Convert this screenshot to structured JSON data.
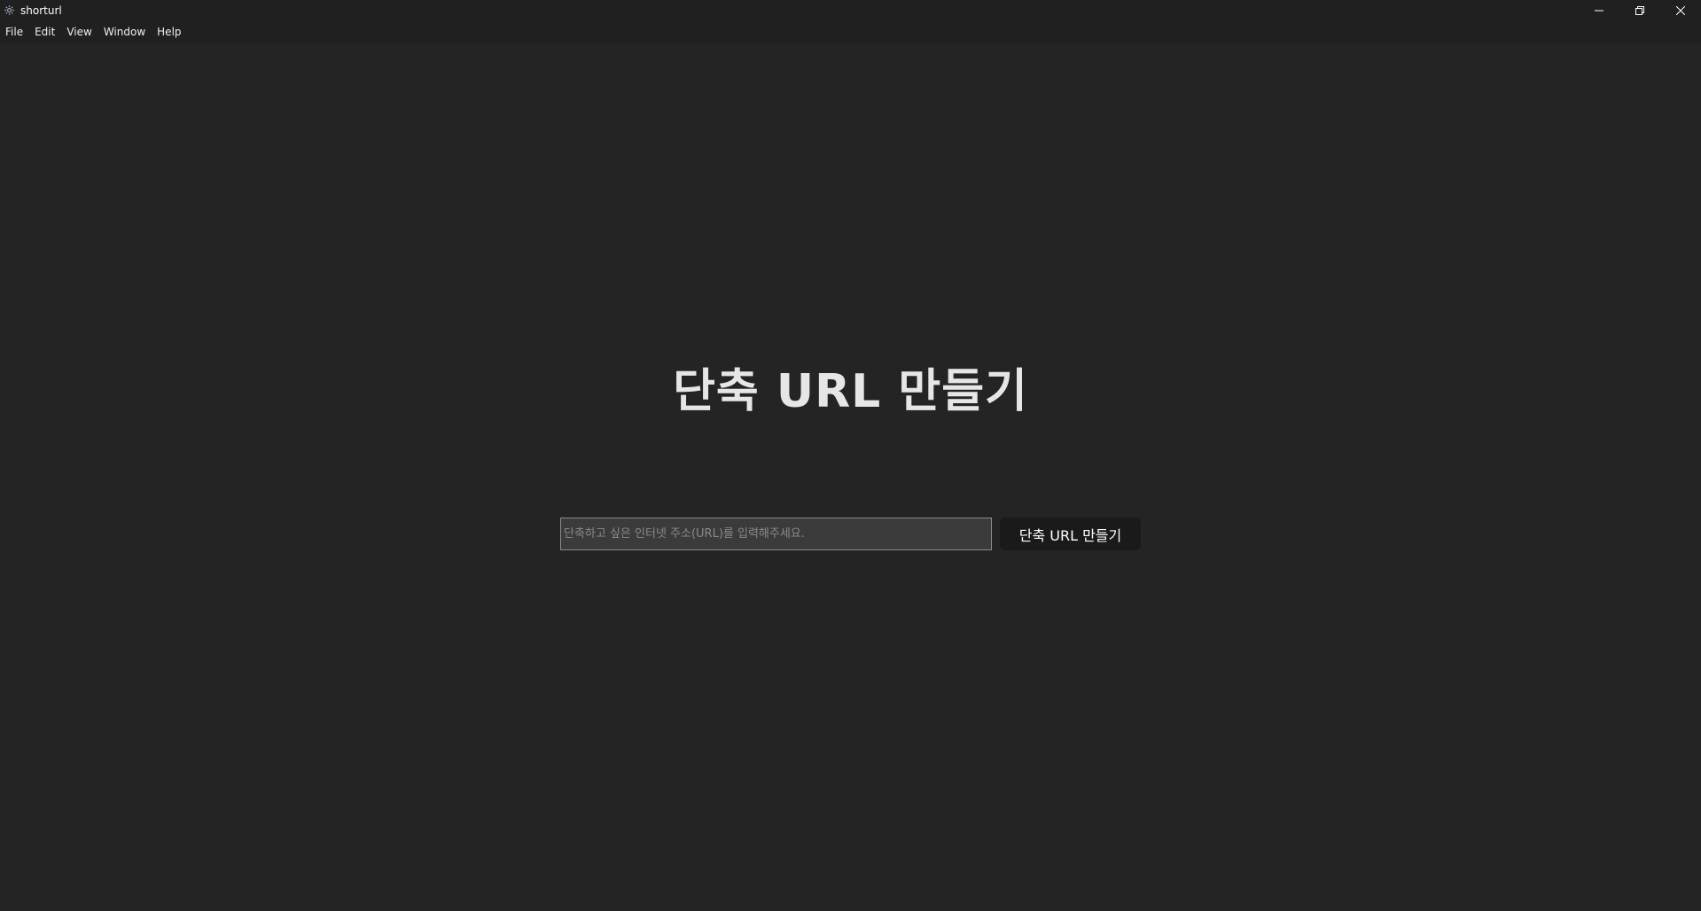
{
  "window": {
    "title": "shorturl",
    "app_icon": "electron-gear-icon",
    "controls": [
      "minimize-icon",
      "restore-icon",
      "close-icon"
    ]
  },
  "menubar": {
    "items": [
      "File",
      "Edit",
      "View",
      "Window",
      "Help"
    ]
  },
  "main": {
    "heading": "단축 URL 만들기",
    "input": {
      "value": "",
      "placeholder": "단축하고 싶은 인터넷 주소(URL)를 입력해주세요."
    },
    "button_label": "단축 URL 만들기"
  },
  "colors": {
    "background": "#242424",
    "titlebar": "#202020",
    "input_bg": "#3b3b3b",
    "button_bg": "#1a1a1a",
    "heading_text": "#e6e6e6"
  }
}
